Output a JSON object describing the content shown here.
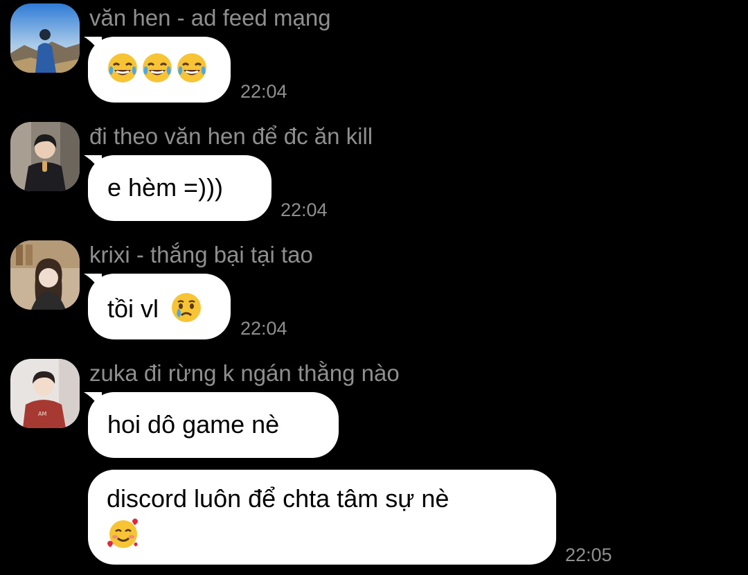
{
  "messages": [
    {
      "sender": "văn hen - ad feed mạng",
      "text": "",
      "emojis": [
        "face-with-tears-of-joy",
        "face-with-tears-of-joy",
        "face-with-tears-of-joy"
      ],
      "time": "22:04"
    },
    {
      "sender": "đi theo văn hen để đc ăn kill",
      "text": "e hèm =)))",
      "time": "22:04"
    },
    {
      "sender": "krixi - thắng bại tại tao",
      "text": "tồi vl",
      "emojis": [
        "crying-face"
      ],
      "time": "22:04"
    },
    {
      "sender": "zuka đi rừng k ngán thằng nào",
      "text": "hoi dô game nè",
      "time": ""
    },
    {
      "sender": "",
      "text": "discord luôn để chta tâm sự nè",
      "emojis": [
        "smiling-face-with-hearts"
      ],
      "time": "22:05"
    }
  ],
  "colors": {
    "background": "#000000",
    "bubble": "#ffffff",
    "meta_text": "#8f8f8f"
  }
}
